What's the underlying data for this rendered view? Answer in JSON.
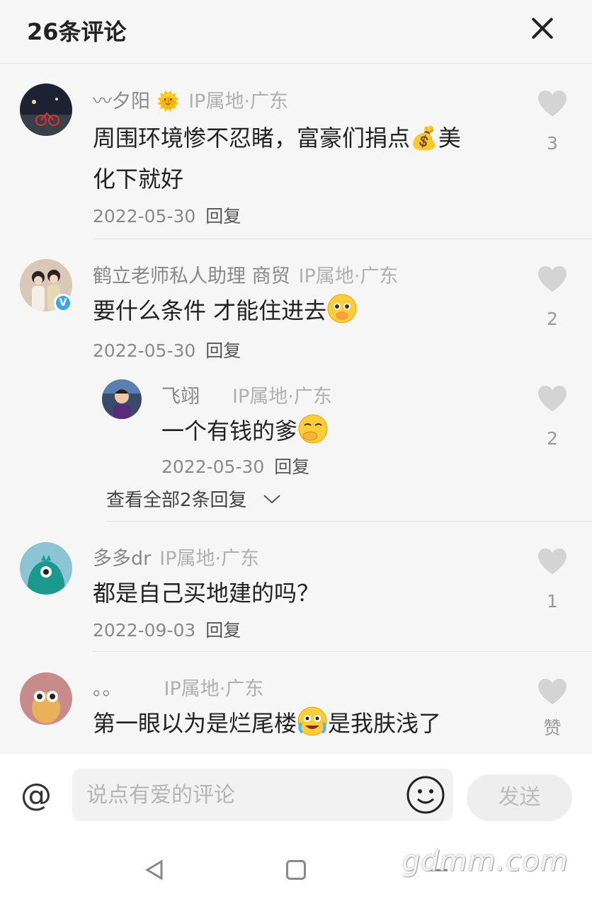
{
  "header": {
    "title": "26条评论"
  },
  "comments": [
    {
      "username": "〰夕阳 🌞",
      "ip": "IP属地·广东",
      "text_lines": [
        "周围环境惨不忍睹，富豪们捐点💰美",
        "化下就好"
      ],
      "date": "2022-05-30",
      "reply_label": "回复",
      "likes": "3"
    },
    {
      "username": "鹤立老师私人助理 商贸",
      "ip": "IP属地·广东",
      "text": "要什么条件 才能住进去",
      "date": "2022-05-30",
      "reply_label": "回复",
      "likes": "2",
      "reply": {
        "username": "飞翊",
        "ip": "IP属地·广东",
        "text": "一个有钱的爹",
        "date": "2022-05-30",
        "reply_label": "回复",
        "likes": "2"
      },
      "view_all": "查看全部2条回复"
    },
    {
      "username": "多多dr",
      "ip": "IP属地·广东",
      "text": "都是自己买地建的吗？",
      "date": "2022-09-03",
      "reply_label": "回复",
      "likes": "1"
    },
    {
      "username": "。。",
      "ip": "IP属地·广东",
      "text_a": "第一眼以为是烂尾楼",
      "text_b": "是我肤浅了",
      "likes": "赞"
    }
  ],
  "input": {
    "at_symbol": "@",
    "placeholder": "说点有爱的评论",
    "send_label": "发送"
  },
  "watermark": "gdmm.com",
  "colors": {
    "background": "#f6f6f6",
    "like_icon": "#d4d4d4",
    "verified": "#3ba5f0"
  }
}
